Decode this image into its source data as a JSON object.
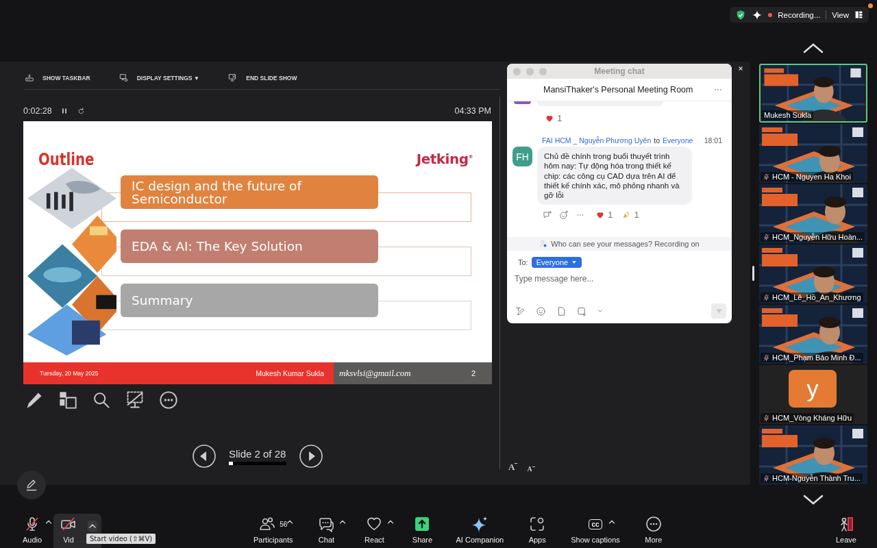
{
  "status_pill": {
    "recording": true,
    "recording_label": "Recording...",
    "view_label": "View"
  },
  "presenter_toolbar": [
    {
      "label": "SHOW TASKBAR"
    },
    {
      "label": "DISPLAY SETTINGS ▼"
    },
    {
      "label": "END SLIDE SHOW"
    }
  ],
  "slideshow": {
    "elapsed": "0:02:28",
    "clock": "04:33 PM"
  },
  "slide": {
    "title": "Outline",
    "logo": "Jetking$^{®}$",
    "items": [
      {
        "text": "IC design and the future of Semiconductor",
        "color": "#e0833f"
      },
      {
        "text": "EDA & AI: The Key Solution",
        "color": "#c07f70"
      },
      {
        "text": "Summary",
        "color": "#a7a7a7"
      }
    ],
    "footer": {
      "date": "Tuesday, 20 May 2025",
      "presenter": "Mukesh Kumar Sukla",
      "email": "mksvlsi@gmail.com",
      "page": "2"
    }
  },
  "slide_nav": {
    "label": "Slide 2 of 28",
    "level": 0.07
  },
  "font_buttons": [
    {
      "label": "A",
      "kind": "increase"
    },
    {
      "label": "A",
      "kind": "decrease"
    }
  ],
  "chat": {
    "title": "Meeting chat",
    "room": "MansiThaker's Personal Meeting Room",
    "previous_reactions": [
      {
        "kind": "heart",
        "count": "1"
      }
    ],
    "messages": [
      {
        "initials": "FH",
        "color": "#3f9e8b",
        "sender": "FAI HCM _ Nguyễn Phương Uyên",
        "to_word": "to",
        "recipient": "Everyone",
        "time": "18:01",
        "text": "Chủ đề chính trong buổi thuyết trình hôm nay: Tự động hóa trong thiết kế chip: các công cụ CAD dựa trên AI để thiết kế chính xác, mô phỏng nhanh và gỡ lỗi",
        "reactions": [
          {
            "kind": "heart",
            "count": "1"
          },
          {
            "kind": "party",
            "count": "1"
          }
        ]
      }
    ],
    "notice": "Who can see your messages? Recording on",
    "to_label": "To:",
    "audience": "Everyone",
    "placeholder": "Type message here..."
  },
  "participants": [
    {
      "name": "Mukesh Sukla",
      "kind": "video",
      "active_speaker": true,
      "muted": false
    },
    {
      "name": "HCM - Nguyen Ha Khoi",
      "kind": "video",
      "active_speaker": false,
      "muted": true
    },
    {
      "name": "HCM_Nguyễn Hữu Hoàn...",
      "kind": "video",
      "active_speaker": false,
      "muted": true
    },
    {
      "name": "HCM_Lê_Hồ_An_Khương",
      "kind": "video",
      "active_speaker": false,
      "muted": true
    },
    {
      "name": "HCM_Phạm Bảo Minh Đ...",
      "kind": "video",
      "active_speaker": false,
      "muted": true
    },
    {
      "name": "HCM_Vòng Kháng Hữu",
      "kind": "avatar",
      "initial": "y",
      "active_speaker": false,
      "muted": true
    },
    {
      "name": "HCM-Nguyễn Thành Tru...",
      "kind": "video",
      "active_speaker": false,
      "muted": true
    }
  ],
  "toolbar": [
    {
      "label": "Audio",
      "muted": true,
      "caret": true,
      "highlighted": false
    },
    {
      "label": "Vid",
      "muted": true,
      "caret": true,
      "highlighted": true
    },
    {
      "label": "Participants",
      "count": "56",
      "muted": false,
      "caret": true,
      "highlighted": false
    },
    {
      "label": "Chat",
      "muted": false,
      "caret": true,
      "highlighted": false
    },
    {
      "label": "React",
      "muted": false,
      "caret": true,
      "highlighted": false
    },
    {
      "label": "Share",
      "muted": false,
      "caret": false,
      "highlighted": false
    },
    {
      "label": "AI Companion",
      "muted": false,
      "caret": false,
      "highlighted": false
    },
    {
      "label": "Apps",
      "muted": false,
      "caret": false,
      "highlighted": false
    },
    {
      "label": "Show captions",
      "glyph": "cc",
      "muted": false,
      "caret": true,
      "highlighted": false
    },
    {
      "label": "More",
      "muted": false,
      "caret": false,
      "highlighted": false
    },
    {
      "label": "Leave",
      "muted": false,
      "caret": false,
      "highlighted": false
    }
  ],
  "tooltip": "Start video (⇧⌘V)"
}
